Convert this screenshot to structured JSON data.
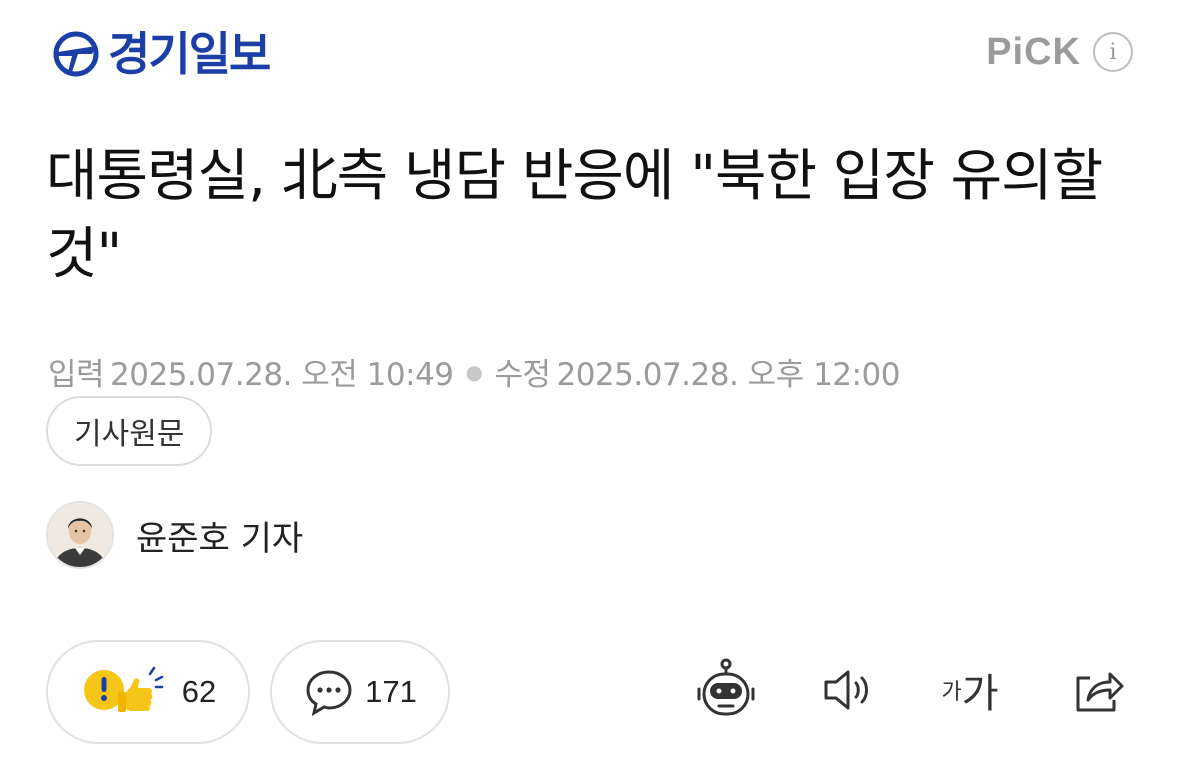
{
  "header": {
    "logo_text": "경기일보",
    "pick_label": "PiCK",
    "info_icon": "info-icon"
  },
  "article": {
    "headline": "대통령실, 北측 냉담 반응에 \"북한 입장 유의할 것\"",
    "input_label": "입력",
    "input_time": "2025.07.28. 오전 10:49",
    "modified_label": "수정",
    "modified_time": "2025.07.28. 오후 12:00",
    "original_button": "기사원문",
    "reporter": "윤준호 기자"
  },
  "actions": {
    "reaction_count": "62",
    "comment_count": "171",
    "font_small": "가",
    "font_big": "가"
  },
  "colors": {
    "logo_blue": "#1b3fa6",
    "muted_gray": "#9b9b9b",
    "reaction_yellow": "#f5c518"
  }
}
